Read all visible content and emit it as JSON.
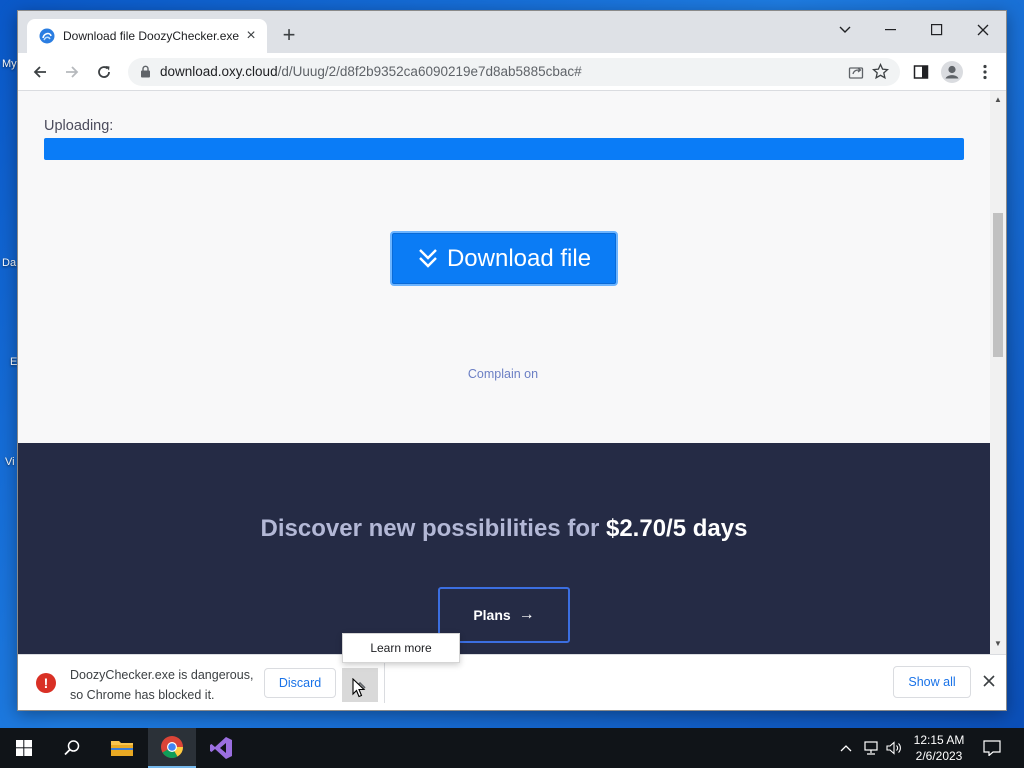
{
  "desktop": {
    "icon_labels": [
      "My",
      "Da",
      "E",
      "Vi"
    ]
  },
  "browser": {
    "tab": {
      "title": "Download file DoozyChecker.exe",
      "close_symbol": "×"
    },
    "new_tab_symbol": "+",
    "url": {
      "host": "download.oxy.cloud",
      "path": "/d/Uuug/2/d8f2b9352ca6090219e7d8ab5885cbac#"
    }
  },
  "page": {
    "uploading_label": "Uploading:",
    "progress_percent": 100,
    "progress_color": "#0a7cf7",
    "download_button_label": "Download file",
    "complain_link": "Complain on",
    "promo": {
      "title_prefix": "Discover new possibilities for ",
      "title_price": "$2.70/5 days",
      "plans_button_label": "Plans",
      "plans_arrow": "→",
      "background": "#252b45"
    }
  },
  "download_shelf": {
    "message_line1": "DoozyChecker.exe is dangerous,",
    "message_line2": "so Chrome has blocked it.",
    "warning_symbol": "!",
    "discard_label": "Discard",
    "show_all_label": "Show all",
    "popup_learn_more": "Learn more"
  },
  "taskbar": {
    "clock_time": "12:15 AM",
    "clock_date": "2/6/2023"
  },
  "colors": {
    "accent_blue": "#0b7cf5",
    "danger_red": "#d93025",
    "link_blue": "#1a73e8"
  }
}
